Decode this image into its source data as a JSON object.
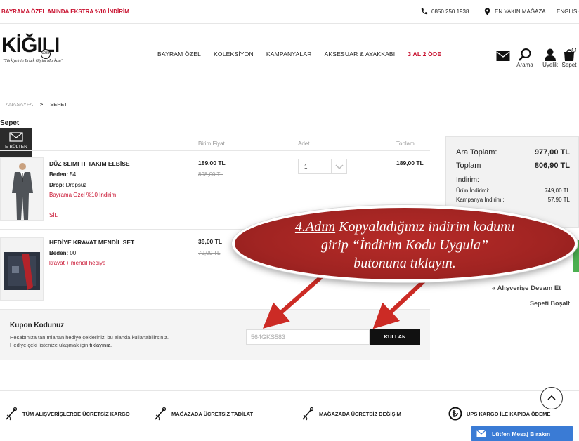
{
  "topbar": {
    "promo": "BAYRAMA ÖZEL ANINDA EKSTRA %10 İNDİRİM",
    "phone": "0850 250 1938",
    "store": "EN YAKIN MAĞAZA",
    "lang": "ENGLISH"
  },
  "brand": {
    "logo": "KİĞILI",
    "badge": "1938",
    "tagline": "\"Türkiye'nin Erkek Giyim Markası\""
  },
  "nav": {
    "items": [
      "BAYRAM ÖZEL",
      "KOLEKSİYON",
      "KAMPANYALAR",
      "AKSESUAR & AYAKKABI",
      "3 AL 2 ÖDE"
    ]
  },
  "header_icons": {
    "search": "Arama",
    "account": "Üyelik",
    "cart": "Sepet"
  },
  "breadcrumb": {
    "home": "ANASAYFA",
    "current": "SEPET"
  },
  "page_title": "Sepet",
  "ebulten": "E-BÜLTEN",
  "columns": {
    "unit_price": "Birim Fiyat",
    "qty": "Adet",
    "total": "Toplam"
  },
  "items": [
    {
      "name": "DÜZ SLIMFIT TAKIM ELBİSE",
      "size_label": "Beden:",
      "size": "54",
      "drop_label": "Drop:",
      "drop": "Dropsuz",
      "promo": "Bayrama Özel %10 İndirim",
      "price": "189,00 TL",
      "old_price": "898,00 TL",
      "qty": "1",
      "total": "189,00 TL",
      "delete": "SİL"
    },
    {
      "name": "HEDİYE KRAVAT MENDİL SET",
      "size_label": "Beden:",
      "size": "00",
      "promo": "kravat + mendil hediye",
      "price": "39,00 TL",
      "old_price": "79,00 TL"
    }
  ],
  "summary": {
    "subtotal_label": "Ara Toplam:",
    "subtotal": "977,00 TL",
    "total_label": "Toplam",
    "total": "806,90 TL",
    "discount_label": "İndirim:",
    "product_discount_label": "Ürün İndirimi:",
    "product_discount": "749,00 TL",
    "campaign_discount_label": "Kampanya İndirimi:",
    "campaign_discount": "57,90 TL"
  },
  "continue_shopping": "« Alışverişe Devam Et",
  "empty_cart": "Sepeti Boşalt",
  "coupon": {
    "title": "Kupon Kodunuz",
    "desc1": "Hesabınıza tanımlanan hediye çeklerinizi bu alanda kullanabilirsiniz.",
    "desc2_prefix": "Hediye çeki listenize ulaşmak için",
    "desc2_link": "tıklayınız.",
    "code": "564GKS583",
    "apply": "KULLAN"
  },
  "callout": {
    "step": "4.Adım",
    "line1_rest": " Kopyaladığınız indirim kodunu",
    "line2": "girip “İndirim Kodu Uygula”",
    "line3": "butonuna tıklayın."
  },
  "features": [
    {
      "pre": "TÜM ALIŞVERİŞLERDE ",
      "bold": "ÜCRETSİZ KARGO"
    },
    {
      "pre": "MAĞAZADA ",
      "bold": "ÜCRETSİZ TADİLAT"
    },
    {
      "pre": "MAĞAZADA ",
      "bold": "ÜCRETSİZ DEĞİŞİM"
    },
    {
      "pre": "UPS KARGO İLE ",
      "bold": "KAPIDA ÖDEME"
    }
  ],
  "chat": "Lütfen Mesaj Bırakın",
  "colors": {
    "accent_red": "#c8102e",
    "callout_red": "#a12422",
    "chat_blue": "#3a7bd5"
  }
}
